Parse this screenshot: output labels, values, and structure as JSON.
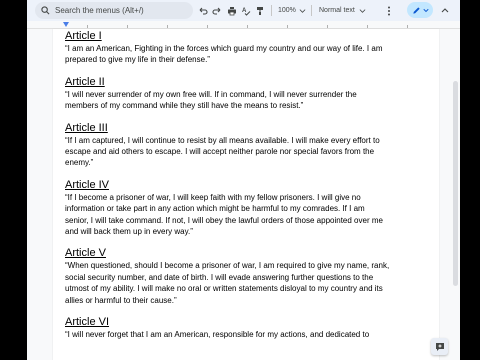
{
  "toolbar": {
    "search_placeholder": "Search the menus (Alt+/)",
    "zoom": "100%",
    "style": "Normal text",
    "icons": [
      "undo-icon",
      "redo-icon",
      "print-icon",
      "spellcheck-icon",
      "paint-format-icon",
      "chevron-down-icon",
      "chevron-down-icon",
      "edit-pencil-icon",
      "chevron-up-icon"
    ]
  },
  "colors": {
    "toolbar_bg": "#edf2fa",
    "accent": "#c2e7ff",
    "ruler_marker": "#4a7ee8"
  },
  "document": {
    "articles": [
      {
        "heading": "Article I",
        "text": "“I am an American, Fighting in the forces which guard my country and our way of life. I am prepared to give my life in their defense.”"
      },
      {
        "heading": "Article II",
        "text": "“I will never surrender of my own free will. If in command, I will never surrender the members of my command while they still have the means to resist.”"
      },
      {
        "heading": "Article III",
        "text": "“If I am captured, I will continue to resist by all means available. I will make every effort to escape and aid others to escape. I will accept neither parole nor special favors from the enemy.”"
      },
      {
        "heading": "Article IV",
        "text": "“If I become a prisoner of war, I will keep faith with my fellow prisoners. I will give no information or take part in any action which might be harmful to my comrades. If I am senior, I will take command. If not, I will obey the lawful orders of those appointed over me and will back them up in every way.”"
      },
      {
        "heading": "Article V",
        "text": "“When questioned, should I become a prisoner of war, I am required to give my name, rank, social security number, and date of birth. I will evade answering further questions to the utmost of my ability. I will make no oral or written statements disloyal to my country and its allies or harmful to their cause.”"
      },
      {
        "heading": "Article VI",
        "text": "“I will never forget that I am an American, responsible for my actions, and dedicated to"
      }
    ]
  }
}
